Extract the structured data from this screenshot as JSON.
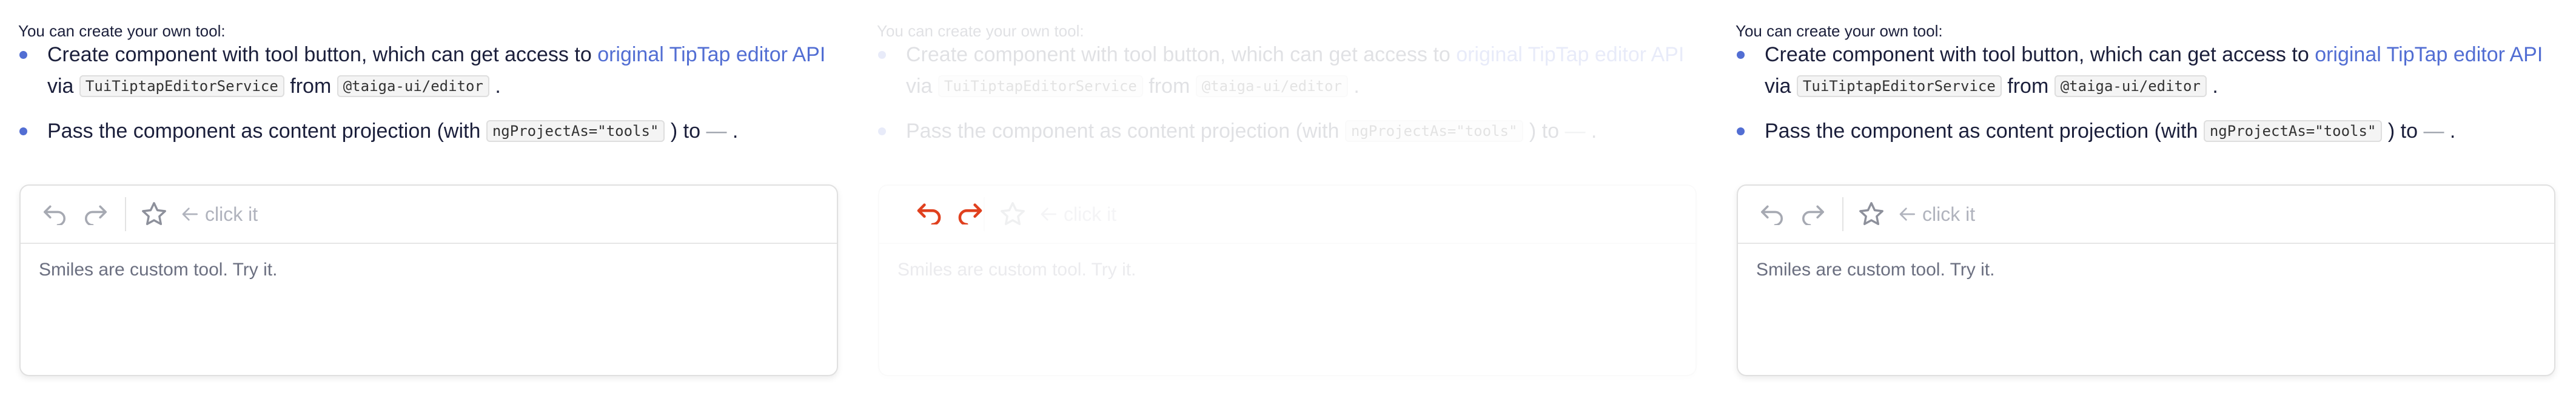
{
  "intro": "You can create your own tool:",
  "bullet1": {
    "text": "Create component with tool button, which can get access to",
    "link": "original TipTap editor API",
    "via": "via",
    "service": "TuiTiptapEditorService",
    "from": "from",
    "package": "@taiga-ui/editor",
    "end": "."
  },
  "bullet2": {
    "text": "Pass the component as content projection (with",
    "code": "ngProjectAs=\"tools\"",
    "to": ") to",
    "dash": "—",
    "end": "."
  },
  "editor": {
    "tool_label": "click it",
    "content": "Smiles are custom tool. Try it."
  },
  "colors": {
    "accent": "#526ed3",
    "undo_active": "#e0401e",
    "icon_muted": "#a6a9b2"
  },
  "icons": [
    "undo-icon",
    "redo-icon",
    "star-icon",
    "arrow-left-icon"
  ]
}
